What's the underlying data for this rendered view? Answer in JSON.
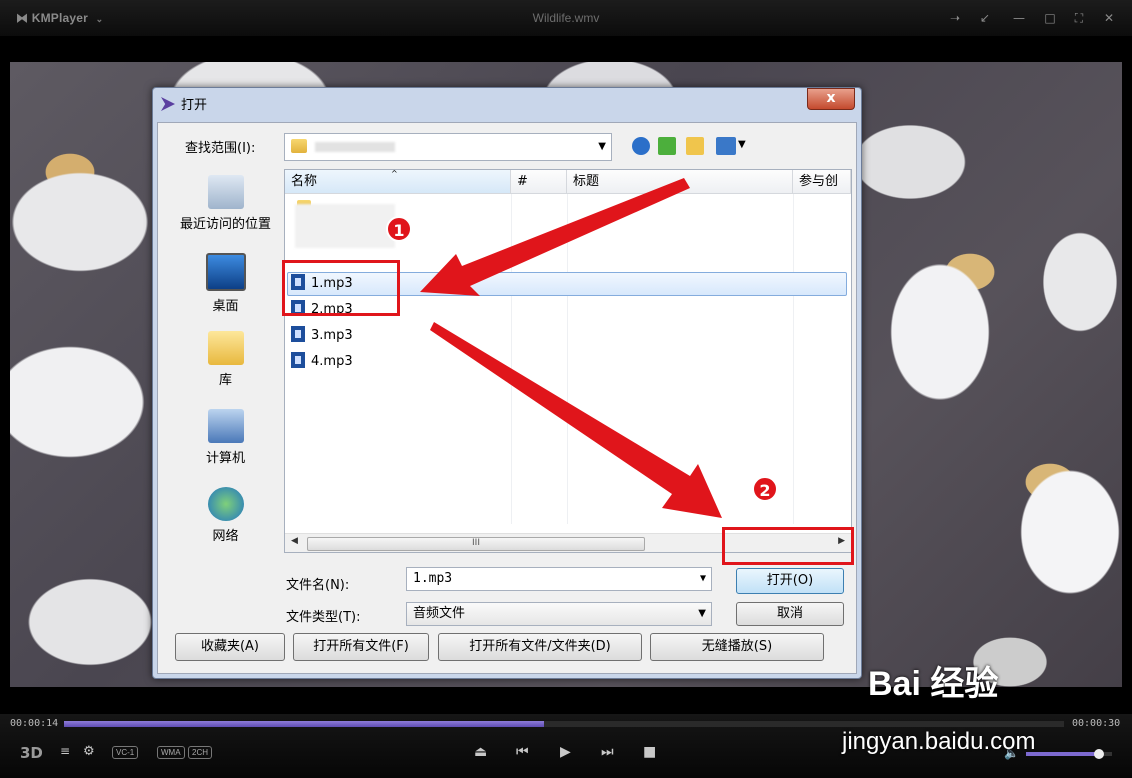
{
  "player": {
    "logo": "KMPlayer",
    "title": "Wildlife.wmv",
    "window_buttons": [
      "pin-icon",
      "compact-icon",
      "minimize-icon",
      "maximize-icon",
      "fullscreen-icon",
      "close-icon"
    ]
  },
  "dialog": {
    "title": "打开",
    "close_label": "x",
    "lookin_label": "查找范围(I):",
    "places": [
      {
        "label": "最近访问的位置",
        "icon": "recent-places-icon"
      },
      {
        "label": "桌面",
        "icon": "desktop-icon"
      },
      {
        "label": "库",
        "icon": "library-icon"
      },
      {
        "label": "计算机",
        "icon": "computer-icon"
      },
      {
        "label": "网络",
        "icon": "network-icon"
      }
    ],
    "columns": [
      "名称",
      "#",
      "标题",
      "参与创"
    ],
    "files": [
      "1.mp3",
      "2.mp3",
      "3.mp3",
      "4.mp3"
    ],
    "selected_file": "1.mp3",
    "scroll_thumb_label": "III",
    "filename_label": "文件名(N):",
    "filename_value": "1.mp3",
    "filetype_label": "文件类型(T):",
    "filetype_value": "音频文件",
    "open_button": "打开(O)",
    "cancel_button": "取消",
    "bottom_buttons": [
      "收藏夹(A)",
      "打开所有文件(F)",
      "打开所有文件/文件夹(D)",
      "无缝播放(S)"
    ]
  },
  "annotations": {
    "badge1": "1",
    "badge2": "2",
    "highlight_color": "#e0151b"
  },
  "controls": {
    "time_current": "00:00:14",
    "time_total": "00:00:30",
    "progress_fraction": 0.48,
    "volume_fraction": 0.85,
    "chips": [
      "VC-1",
      "WMA",
      "2CH"
    ],
    "label_3d": "3D"
  },
  "watermark": {
    "brand": "Bai 经验",
    "url": "jingyan.baidu.com"
  }
}
